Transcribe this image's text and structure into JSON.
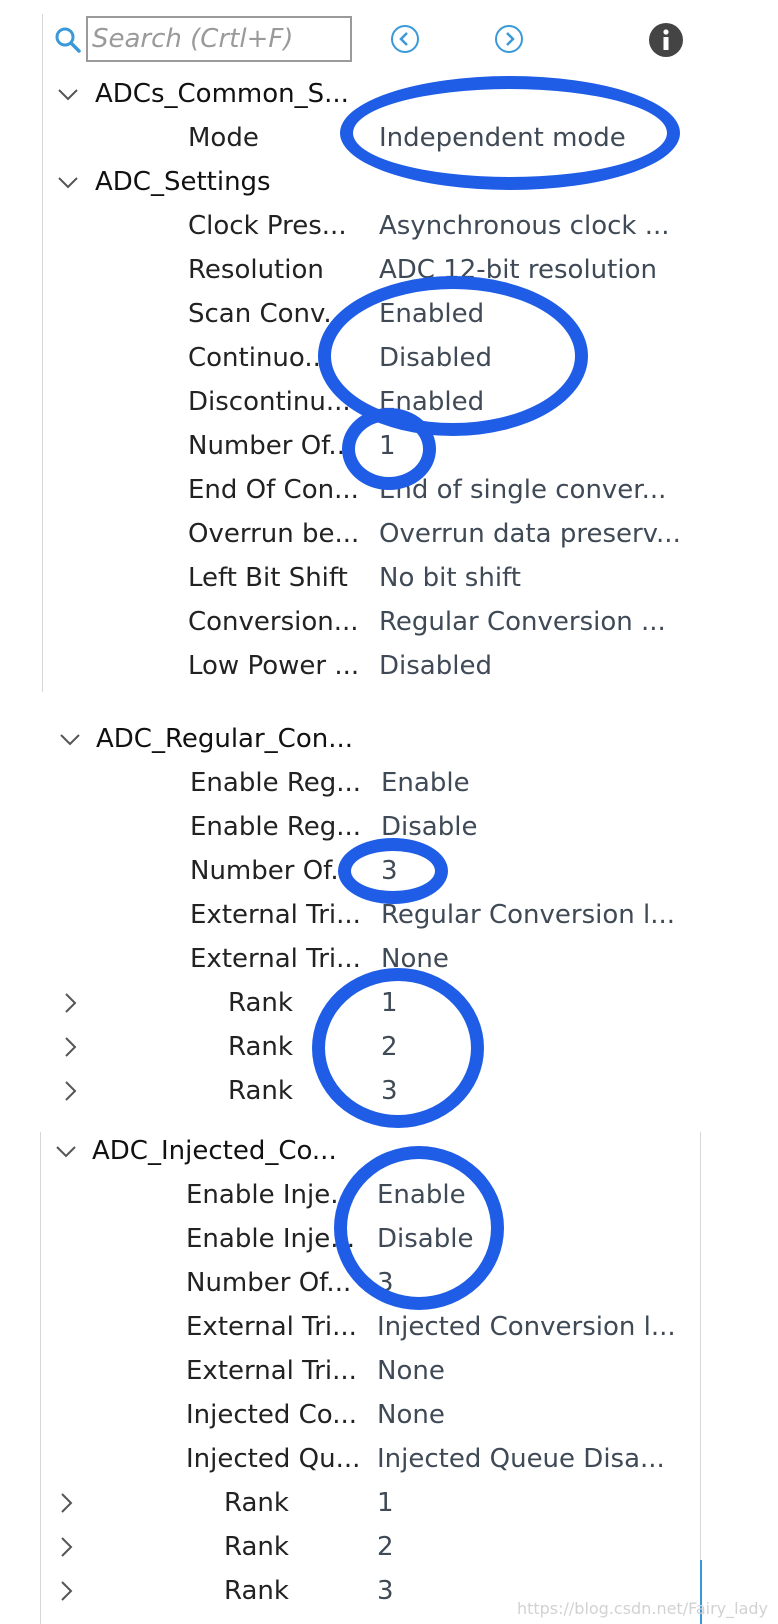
{
  "toolbar": {
    "search_placeholder": "Search (Crtl+F)"
  },
  "groups": {
    "common": {
      "title": "ADCs_Common_S...",
      "mode_label": "Mode",
      "mode_value": "Independent mode"
    },
    "settings": {
      "title": "ADC_Settings",
      "rows": [
        {
          "label": "Clock Pres...",
          "value": "Asynchronous clock ..."
        },
        {
          "label": "Resolution",
          "value": "ADC 12-bit resolution"
        },
        {
          "label": "Scan Conv...",
          "value": "Enabled"
        },
        {
          "label": "Continuo...",
          "value": "Disabled"
        },
        {
          "label": "Discontinu...",
          "value": "Enabled"
        },
        {
          "label": "Number Of...",
          "value": "1"
        },
        {
          "label": "End Of Con...",
          "value": "End of single conver..."
        },
        {
          "label": "Overrun be...",
          "value": "Overrun data preserv..."
        },
        {
          "label": "Left Bit Shift",
          "value": "No bit shift"
        },
        {
          "label": "Conversion...",
          "value": "Regular Conversion ..."
        },
        {
          "label": "Low Power ...",
          "value": "Disabled"
        }
      ]
    },
    "regular": {
      "title": "ADC_Regular_Con...",
      "rows": [
        {
          "label": "Enable Reg...",
          "value": "Enable"
        },
        {
          "label": "Enable Reg...",
          "value": "Disable"
        },
        {
          "label": "Number Of...",
          "value": "3"
        },
        {
          "label": "External Tri...",
          "value": "Regular Conversion l..."
        },
        {
          "label": "External Tri...",
          "value": "None"
        }
      ],
      "ranks": [
        {
          "label": "Rank",
          "value": "1"
        },
        {
          "label": "Rank",
          "value": "2"
        },
        {
          "label": "Rank",
          "value": "3"
        }
      ]
    },
    "injected": {
      "title": "ADC_Injected_Co...",
      "rows": [
        {
          "label": "Enable Inje...",
          "value": "Enable"
        },
        {
          "label": "Enable Inje...",
          "value": "Disable"
        },
        {
          "label": "Number Of...",
          "value": "3"
        },
        {
          "label": "External Tri...",
          "value": "Injected Conversion l..."
        },
        {
          "label": "External Tri...",
          "value": "None"
        },
        {
          "label": "Injected Co...",
          "value": "None"
        },
        {
          "label": "Injected Qu...",
          "value": "Injected Queue Disa..."
        }
      ],
      "ranks": [
        {
          "label": "Rank",
          "value": "1"
        },
        {
          "label": "Rank",
          "value": "2"
        },
        {
          "label": "Rank",
          "value": "3"
        }
      ]
    }
  },
  "watermark": "https://blog.csdn.net/Fairy_lady",
  "colors": {
    "annotation": "#1f5de6",
    "icon_blue": "#3a9ad9"
  }
}
